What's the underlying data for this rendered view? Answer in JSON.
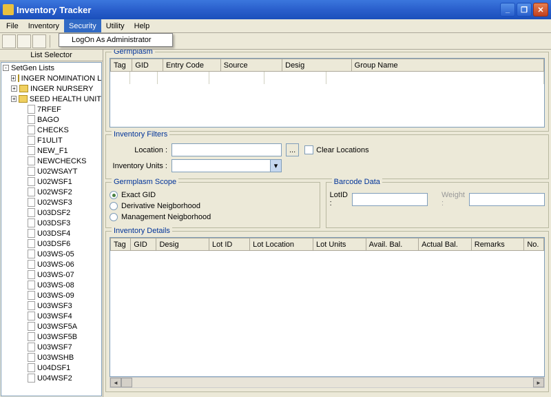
{
  "window": {
    "title": "Inventory Tracker"
  },
  "menu": {
    "file": "File",
    "inventory": "Inventory",
    "security": "Security",
    "utility": "Utility",
    "help": "Help",
    "logon_admin": "LogOn As Administrator"
  },
  "sidebar": {
    "header": "List Selector",
    "root": "SetGen Lists",
    "folders": [
      "INGER NOMINATION LIS",
      "INGER NURSERY",
      "SEED HEALTH UNIT"
    ],
    "items": [
      "7RFEF",
      "BAGO",
      "CHECKS",
      "F1ULIT",
      "NEW_F1",
      "NEWCHECKS",
      "U02WSAYT",
      "U02WSF1",
      "U02WSF2",
      "U02WSF3",
      "U03DSF2",
      "U03DSF3",
      "U03DSF4",
      "U03DSF6",
      "U03WS-05",
      "U03WS-06",
      "U03WS-07",
      "U03WS-08",
      "U03WS-09",
      "U03WSF3",
      "U03WSF4",
      "U03WSF5A",
      "U03WSF5B",
      "U03WSF7",
      "U03WSHB",
      "U04DSF1",
      "U04WSF2"
    ]
  },
  "groups": {
    "germplasm": "Germplasm",
    "inv_filters": "Inventory Filters",
    "germ_scope": "Germplasm Scope",
    "barcode": "Barcode Data",
    "inv_details": "Inventory Details"
  },
  "germ_cols": [
    "Tag",
    "GID",
    "Entry Code",
    "Source",
    "Desig",
    "Group Name"
  ],
  "filters": {
    "location_label": "Location :",
    "browse": "...",
    "clear_loc": "Clear Locations",
    "units_label": "Inventory Units :"
  },
  "scope": {
    "exact": "Exact GID",
    "deriv": "Derivative Neigborhood",
    "mgmt": "Management Neigborhood"
  },
  "barcode": {
    "lotid": "LotID :",
    "weight": "Weight :"
  },
  "detail_cols": [
    "Tag",
    "GID",
    "Desig",
    "Lot ID",
    "Lot Location",
    "Lot Units",
    "Avail. Bal.",
    "Actual Bal.",
    "Remarks",
    "No."
  ]
}
